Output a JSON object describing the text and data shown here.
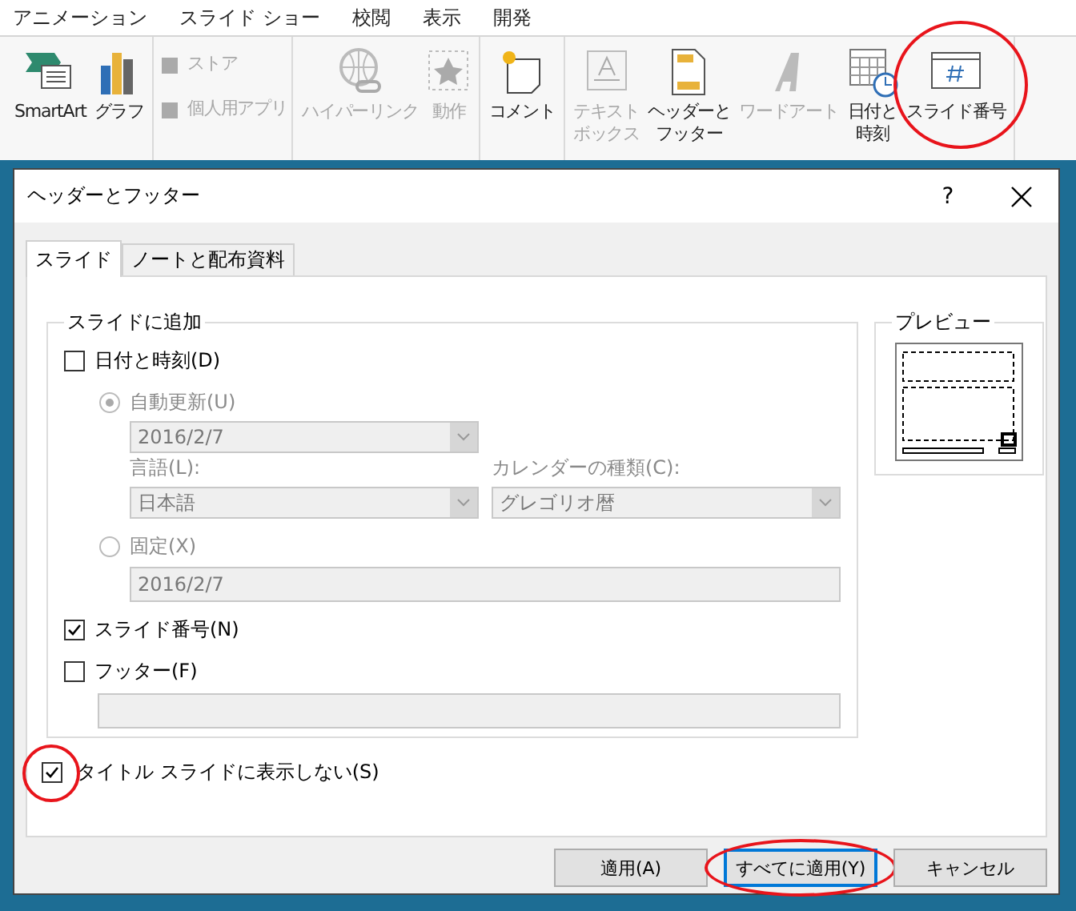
{
  "ribbon_tabs": [
    "アニメーション",
    "スライド ショー",
    "校閲",
    "表示",
    "開発"
  ],
  "ribbon_groups": [
    {
      "items": [
        {
          "kind": "large",
          "lines": [
            "SmartArt"
          ],
          "disabled": false
        },
        {
          "kind": "large",
          "lines": [
            "グラフ"
          ],
          "disabled": false
        }
      ]
    },
    {
      "items": [
        {
          "kind": "stack",
          "lines": [
            "ストア",
            "個人用アプリ"
          ],
          "disabled": true
        }
      ]
    },
    {
      "items": [
        {
          "kind": "large",
          "lines": [
            "ハイパーリンク"
          ],
          "disabled": true
        },
        {
          "kind": "large",
          "lines": [
            "動作"
          ],
          "disabled": true
        }
      ]
    },
    {
      "items": [
        {
          "kind": "large",
          "lines": [
            "コメント"
          ],
          "disabled": false
        }
      ]
    },
    {
      "items": [
        {
          "kind": "large",
          "lines": [
            "テキスト",
            "ボックス"
          ],
          "disabled": true
        },
        {
          "kind": "large",
          "lines": [
            "ヘッダーと",
            "フッター"
          ],
          "disabled": false
        },
        {
          "kind": "large",
          "lines": [
            "ワードアート"
          ],
          "disabled": true
        },
        {
          "kind": "large",
          "lines": [
            "日付と",
            "時刻"
          ],
          "disabled": false
        },
        {
          "kind": "large",
          "lines": [
            "スライド番号"
          ],
          "disabled": false,
          "highlighted": true
        }
      ]
    }
  ],
  "dialog": {
    "title": "ヘッダーとフッター",
    "help": "?"
  },
  "tabs": [
    {
      "label": "スライド",
      "selected": true
    },
    {
      "label": "ノートと配布資料",
      "selected": false
    }
  ],
  "add_group": {
    "title": "スライドに追加",
    "date_time": {
      "label": "日付と時刻(D)",
      "checked": false
    },
    "auto_update": {
      "label": "自動更新(U)",
      "selected": true,
      "disabled": true
    },
    "date_select": {
      "value": "2016/2/7",
      "disabled": true
    },
    "language": {
      "label": "言語(L):",
      "value": "日本語",
      "disabled": true
    },
    "calendar": {
      "label": "カレンダーの種類(C):",
      "value": "グレゴリオ暦",
      "disabled": true
    },
    "fixed": {
      "label": "固定(X)",
      "selected": false,
      "disabled": true
    },
    "fixed_field": {
      "value": "2016/2/7",
      "disabled": true
    },
    "slide_number": {
      "label": "スライド番号(N)",
      "checked": true
    },
    "footer": {
      "label": "フッター(F)",
      "checked": false
    },
    "footer_field": {
      "disabled": true
    }
  },
  "preview": {
    "title": "プレビュー"
  },
  "title_slide": {
    "label": "タイトル スライドに表示しない(S)",
    "checked": true,
    "highlighted": true
  },
  "buttons": [
    {
      "label": "適用(A)",
      "default": false
    },
    {
      "label": "すべてに適用(Y)",
      "default": true,
      "highlighted": true
    },
    {
      "label": "キャンセル",
      "default": false
    }
  ]
}
